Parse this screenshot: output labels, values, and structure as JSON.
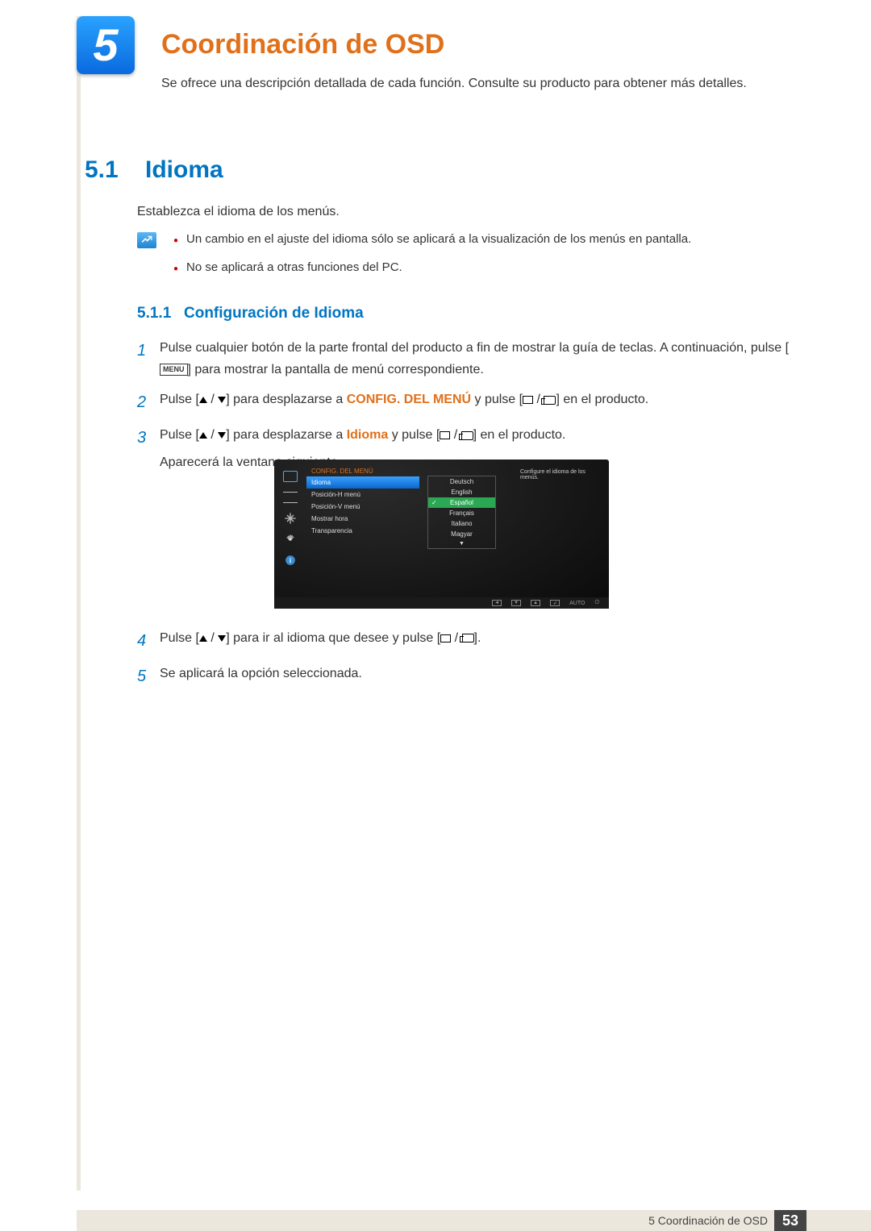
{
  "chapter": {
    "number": "5",
    "title": "Coordinación de OSD",
    "description": "Se ofrece una descripción detallada de cada función. Consulte su producto para obtener más detalles."
  },
  "section": {
    "number": "5.1",
    "title": "Idioma",
    "description": "Establezca el idioma de los menús."
  },
  "notes": {
    "bullet1": "Un cambio en el ajuste del idioma sólo se aplicará a la visualización de los menús en pantalla.",
    "bullet2": "No se aplicará a otras funciones del PC."
  },
  "subsection": {
    "number": "5.1.1",
    "title": "Configuración de Idioma"
  },
  "steps": {
    "s1a": "Pulse cualquier botón de la parte frontal del producto a fin de mostrar la guía de teclas. A continuación, pulse [",
    "s1b": "] para mostrar la pantalla de menú correspondiente.",
    "menu_label": "MENU",
    "s2a": "Pulse [",
    "s2b": "] para desplazarse a ",
    "s2c_highlight": "CONFIG. DEL MENÚ",
    "s2d": " y pulse [",
    "s2e": "] en el producto.",
    "s3a": "Pulse [",
    "s3b": "] para desplazarse a ",
    "s3c_highlight": "Idioma",
    "s3d": " y pulse [",
    "s3e": "] en el producto.",
    "s3f": "Aparecerá la ventana siguiente.",
    "s4a": "Pulse [",
    "s4b": "] para ir al idioma que desee y pulse [",
    "s4c": "].",
    "s5": "Se aplicará la opción seleccionada."
  },
  "osd": {
    "menu_title": "CONFIG. DEL MENÚ",
    "menu_items": [
      "Idioma",
      "Posición-H menú",
      "Posición-V menú",
      "Mostrar hora",
      "Transparencia"
    ],
    "languages": [
      "Deutsch",
      "English",
      "Español",
      "Français",
      "Italiano",
      "Magyar"
    ],
    "hint": "Configure el idioma de los menús.",
    "bar_auto": "AUTO"
  },
  "footer": {
    "text": "5 Coordinación de OSD",
    "page": "53"
  }
}
